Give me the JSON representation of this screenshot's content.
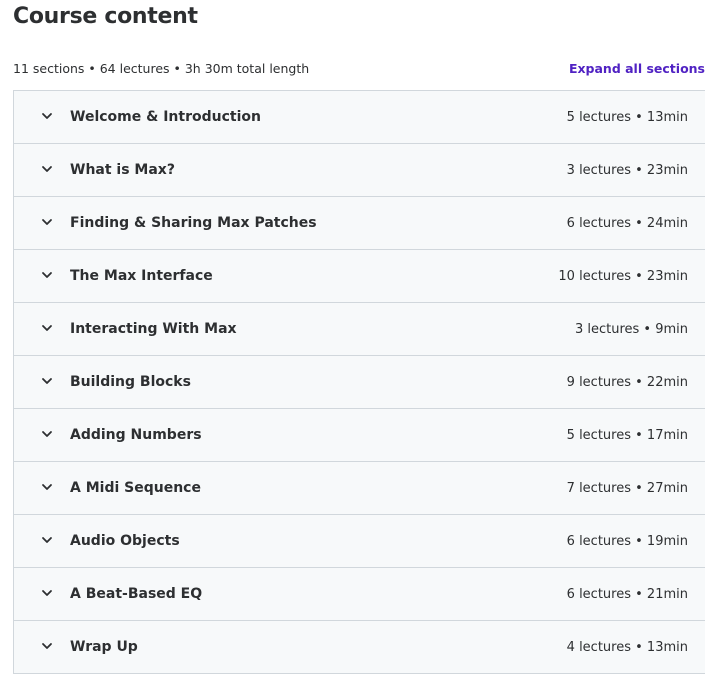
{
  "header": {
    "title": "Course content",
    "summary": "11 sections • 64 lectures • 3h 30m total length",
    "expand_label": "Expand all sections"
  },
  "icons": {
    "section_toggle": "chevron-down-icon"
  },
  "colors": {
    "accent": "#5022c3",
    "row_background": "#f7f9fa",
    "border": "#d1d7dc",
    "text": "#2d2f31"
  },
  "sections": [
    {
      "title": "Welcome & Introduction",
      "meta": "5 lectures • 13min"
    },
    {
      "title": "What is Max?",
      "meta": "3 lectures • 23min"
    },
    {
      "title": "Finding & Sharing Max Patches",
      "meta": "6 lectures • 24min"
    },
    {
      "title": "The Max Interface",
      "meta": "10 lectures • 23min"
    },
    {
      "title": "Interacting With Max",
      "meta": "3 lectures • 9min"
    },
    {
      "title": "Building Blocks",
      "meta": "9 lectures • 22min"
    },
    {
      "title": "Adding Numbers",
      "meta": "5 lectures • 17min"
    },
    {
      "title": "A Midi Sequence",
      "meta": "7 lectures • 27min"
    },
    {
      "title": "Audio Objects",
      "meta": "6 lectures • 19min"
    },
    {
      "title": "A Beat-Based EQ",
      "meta": "6 lectures • 21min"
    },
    {
      "title": "Wrap Up",
      "meta": "4 lectures • 13min"
    }
  ]
}
